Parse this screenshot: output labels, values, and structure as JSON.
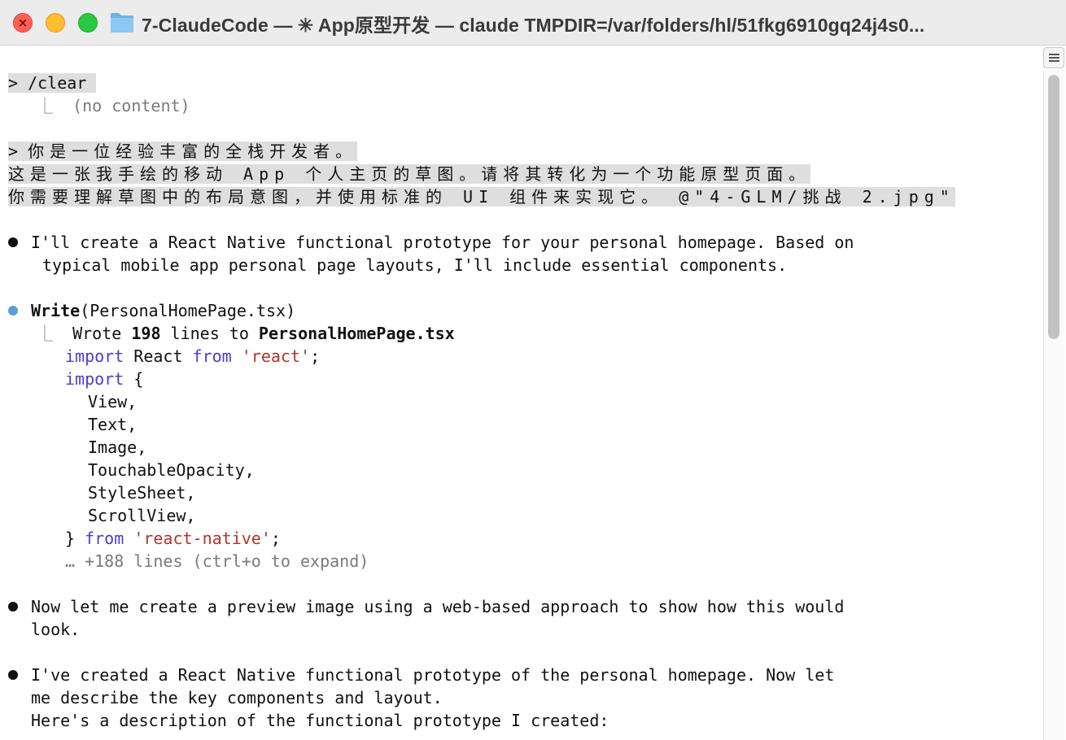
{
  "window": {
    "title": "7-ClaudeCode — ✳ App原型开发 — claude TMPDIR=/var/folders/hl/51fkg6910gq24j4s0..."
  },
  "terminal": {
    "clear_cmd": "> /clear",
    "clear_result_prefix": "⎿",
    "clear_result": "(no content)",
    "prompt_line1_marker": ">",
    "prompt_line1": "你是一位经验丰富的全栈开发者。",
    "prompt_line2": "这是一张我手绘的移动 App 个人主页的草图。请将其转化为一个功能原型页面。",
    "prompt_line3": "你需要理解草图中的布局意图，并使用标准的 UI 组件来实现它。 @\"4-GLM/挑战 2.jpg\"",
    "msg1_line1": "I'll create a React Native functional prototype for your personal homepage. Based on",
    "msg1_line2": "typical mobile app personal page layouts, I'll include essential components.",
    "tool_name": "Write",
    "tool_arg": "(PersonalHomePage.tsx)",
    "tool_result_prefix": "⎿",
    "tool_wrote": "Wrote",
    "tool_lines": "198",
    "tool_lines_to": "lines to",
    "tool_file": "PersonalHomePage.tsx",
    "code": {
      "l1_kw": "import",
      "l1_mid": " React ",
      "l1_kw2": "from",
      "l1_str": "'react'",
      "l1_end": ";",
      "l2_kw": "import",
      "l2_end": " {",
      "items": [
        "View,",
        "Text,",
        "Image,",
        "TouchableOpacity,",
        "StyleSheet,",
        "ScrollView,"
      ],
      "l9_start": "} ",
      "l9_kw": "from",
      "l9_str": "'react-native'",
      "l9_end": ";",
      "more": "… +188 lines (ctrl+o to expand)"
    },
    "msg2_line1": "Now let me create a preview image using a web-based approach to show how this would",
    "msg2_line2": "look.",
    "msg3_line1": "I've created a React Native functional prototype of the personal homepage. Now let",
    "msg3_line2": "me describe the key components and layout.",
    "msg3_line3": "Here's a description of the functional prototype I created:"
  },
  "icons": {
    "close": "close-icon",
    "minimize": "minimize-icon",
    "zoom": "zoom-icon",
    "folder": "folder-icon",
    "scroll_toggle": "scroll-toggle-icon"
  },
  "colors": {
    "keyword": "#4b3ccf",
    "string": "#b33526",
    "tool_bullet": "#5a9fd4",
    "prompt_highlight": "#dedede"
  }
}
